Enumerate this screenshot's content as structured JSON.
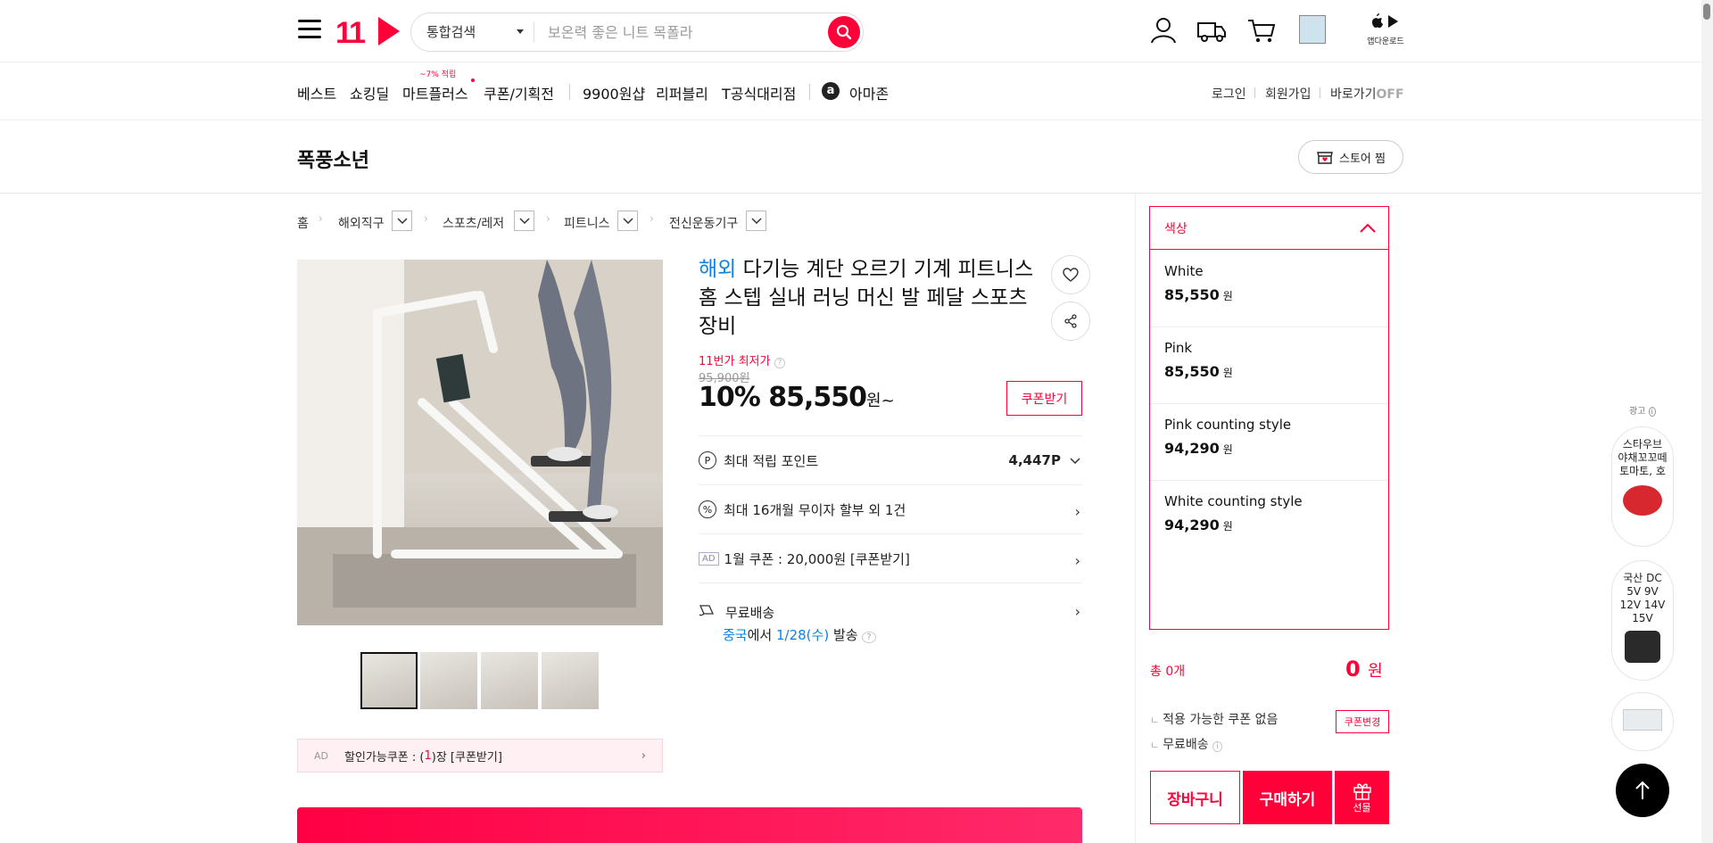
{
  "header": {
    "logo": "11",
    "search": {
      "category": "통합검색",
      "placeholder": "보온력 좋은 니트 목폴라"
    },
    "app_download": "앱다운로드"
  },
  "nav": {
    "items": [
      "베스트",
      "쇼킹딜",
      "마트플러스",
      "쿠폰/기획전",
      "9900원샵",
      "리퍼블리",
      "T공식대리점",
      "아마존"
    ],
    "mart_badge": "~7% 적립",
    "util": {
      "login": "로그인",
      "signup": "회원가입",
      "shortcut": "바로가기",
      "shortcut_state": "OFF"
    }
  },
  "store": {
    "name": "폭풍소년",
    "fav_label": "스토어 찜"
  },
  "breadcrumb": [
    "홈",
    "해외직구",
    "스포츠/레저",
    "피트니스",
    "전신운동기구"
  ],
  "product": {
    "tag": "해외",
    "title": "다기능 계단 오르기 기계 피트니스 홈 스텝 실내 러닝 머신 발 페달 스포츠 장비",
    "lowest_label": "11번가 최저가",
    "original_price": "95,900원",
    "discount": "10%",
    "price": "85,550",
    "price_unit": "원~",
    "coupon_button": "쿠폰받기",
    "points_label": "최대 적립 포인트",
    "points_value": "4,447P",
    "installment": "최대 16개월 무이자 할부 외 1건",
    "ad_tag": "AD",
    "ad_coupon": "1월 쿠폰 : 20,000원 [쿠폰받기]",
    "shipping": "무료배송",
    "ship_origin": "중국",
    "ship_mid": "에서",
    "ship_date": "1/28(수)",
    "ship_end": "발송",
    "coupon_strip_ad": "AD",
    "coupon_strip_pre": "할인가능쿠폰 : (",
    "coupon_strip_count": "1",
    "coupon_strip_post": ")장 [쿠폰받기]"
  },
  "options": {
    "header": "색상",
    "items": [
      {
        "name": "White",
        "price": "85,550",
        "unit": "원"
      },
      {
        "name": "Pink",
        "price": "85,550",
        "unit": "원"
      },
      {
        "name": "Pink counting style",
        "price": "94,290",
        "unit": "원"
      },
      {
        "name": "White counting style",
        "price": "94,290",
        "unit": "원"
      }
    ]
  },
  "summary": {
    "total_label": "총 0개",
    "total_value": "0",
    "total_unit": "원",
    "no_coupon": "적용 가능한 쿠폰 없음",
    "coupon_change": "쿠폰변경",
    "free_ship": "무료배송",
    "cart": "장바구니",
    "buy": "구매하기",
    "gift": "선물"
  },
  "side_ads": {
    "label": "광고",
    "ad1": "스타우브 야채꼬꼬떼 토마토, 호",
    "ad2": "국산 DC 5V 9V 12V 14V 15V"
  },
  "colors": {
    "accent": "#ff0038",
    "link": "#0b83e6"
  }
}
